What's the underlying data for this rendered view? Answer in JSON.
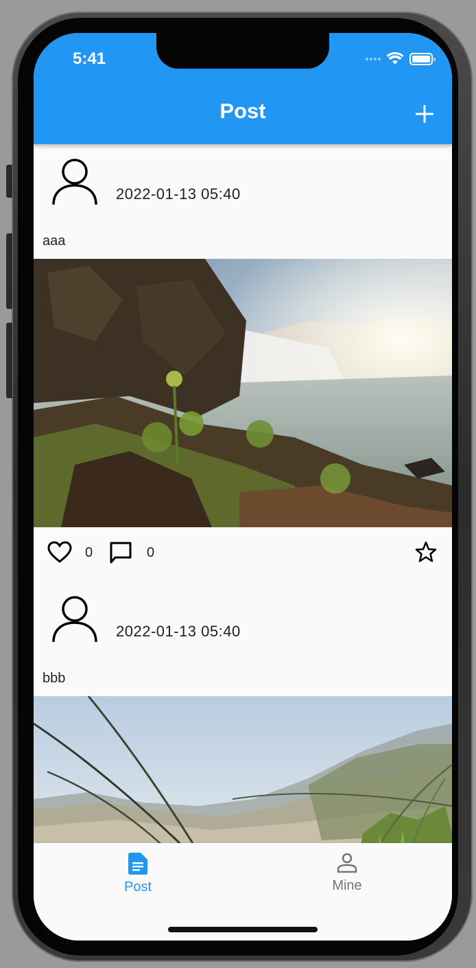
{
  "status_bar": {
    "time": "5:41"
  },
  "app_bar": {
    "title": "Post",
    "add_icon": "plus-icon"
  },
  "posts": [
    {
      "avatar_icon": "person-outline-icon",
      "time": "2022-01-13 05:40",
      "text": "aaa",
      "image": "waterfall-landscape-photo",
      "likes": "0",
      "comments": "0"
    },
    {
      "avatar_icon": "person-outline-icon",
      "time": "2022-01-13 05:40",
      "text": "bbb",
      "image": "beach-grass-photo"
    }
  ],
  "bottom_nav": {
    "items": [
      {
        "label": "Post",
        "icon": "document-icon",
        "active": true
      },
      {
        "label": "Mine",
        "icon": "person-icon",
        "active": false
      }
    ]
  },
  "colors": {
    "primary": "#2196f3",
    "inactive": "#757575",
    "background": "#fafafa"
  }
}
